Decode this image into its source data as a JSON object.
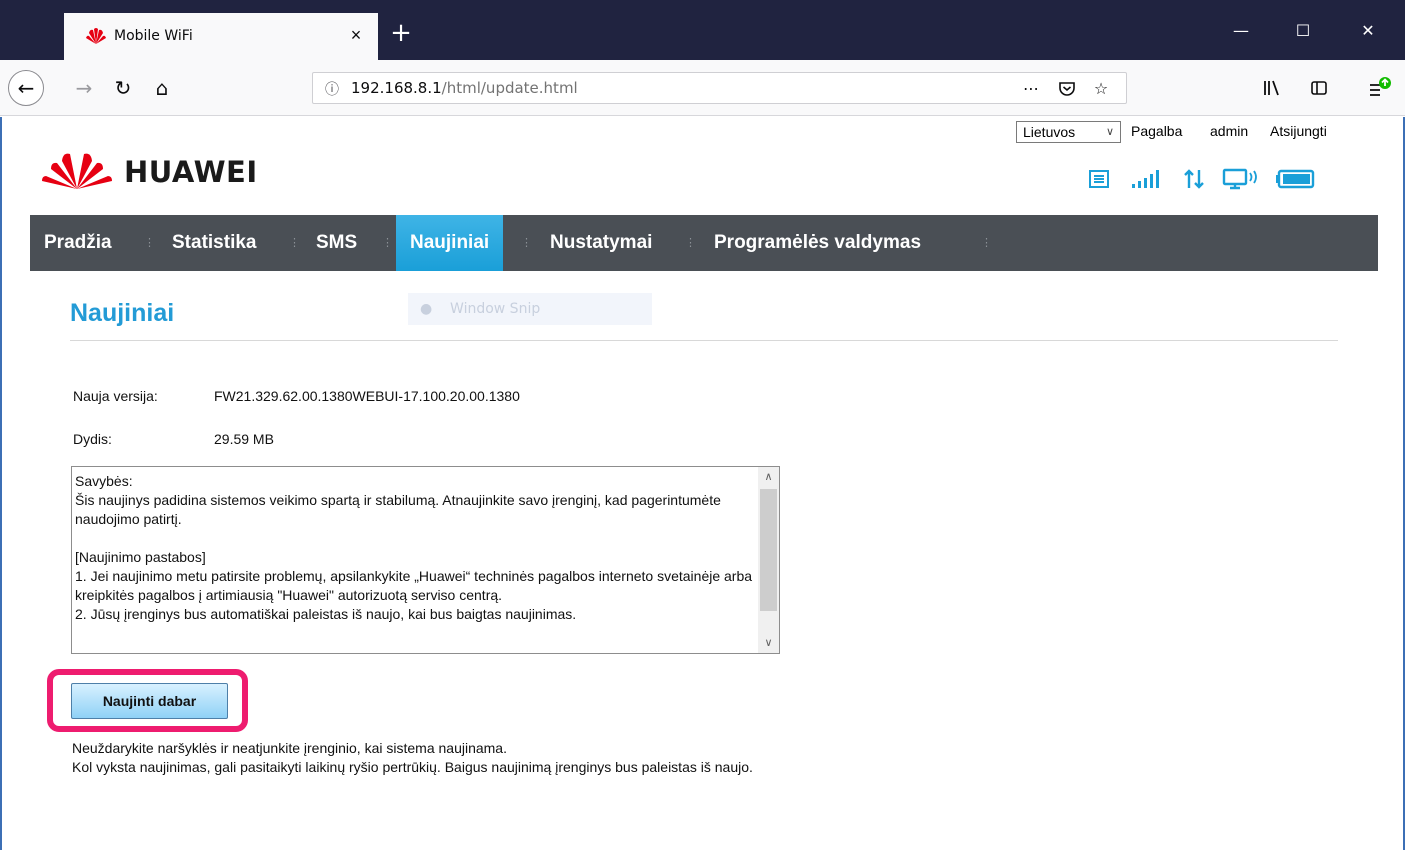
{
  "browser": {
    "tab_title": "Mobile WiFi",
    "tab_close": "×",
    "new_tab": "+",
    "url_host": "192.168.8.1",
    "url_path": "/html/update.html",
    "window_controls": {
      "minimize": "—",
      "maximize": "☐",
      "close": "✕"
    }
  },
  "header": {
    "language": "Lietuvos",
    "help_link": "Pagalba",
    "user_link": "admin",
    "logout_link": "Atsijungti",
    "brand": "HUAWEI"
  },
  "nav": {
    "items": [
      {
        "label": "Pradžia"
      },
      {
        "label": "Statistika"
      },
      {
        "label": "SMS"
      },
      {
        "label": "Naujiniai"
      },
      {
        "label": "Nustatymai"
      },
      {
        "label": "Programėlės valdymas"
      }
    ]
  },
  "overlay": {
    "snip_label": "Window Snip"
  },
  "content": {
    "title": "Naujiniai",
    "version_label": "Nauja versija:",
    "version_value": "FW21.329.62.00.1380WEBUI-17.100.20.00.1380",
    "size_label": "Dydis:",
    "size_value": "29.59 MB",
    "release_notes": "Savybės:\nŠis naujinys padidina sistemos veikimo spartą ir stabilumą. Atnaujinkite savo įrenginį, kad pagerintumėte naudojimo patirtį.\n\n[Naujinimo pastabos]\n1. Jei naujinimo metu patirsite problemų, apsilankykite „Huawei“ techninės pagalbos interneto svetainėje arba kreipkitės pagalbos į artimiausią \"Huawei\" autorizuotą serviso centrą.\n2. Jūsų įrenginys bus automatiškai paleistas iš naujo, kai bus baigtas naujinimas.",
    "update_button": "Naujinti dabar",
    "warning_line1": "Neuždarykite naršyklės ir neatjunkite įrenginio, kai sistema naujinama.",
    "warning_line2": "Kol vyksta naujinimas, gali pasitaikyti laikinų ryšio pertrūkių. Baigus naujinimą įrenginys bus paleistas iš naujo."
  },
  "colors": {
    "accent": "#239bd6",
    "nav_bg": "#4a4f55",
    "nav_active": "#1a9fd8",
    "highlight": "#ee1c6f",
    "brand_red": "#e60012"
  }
}
